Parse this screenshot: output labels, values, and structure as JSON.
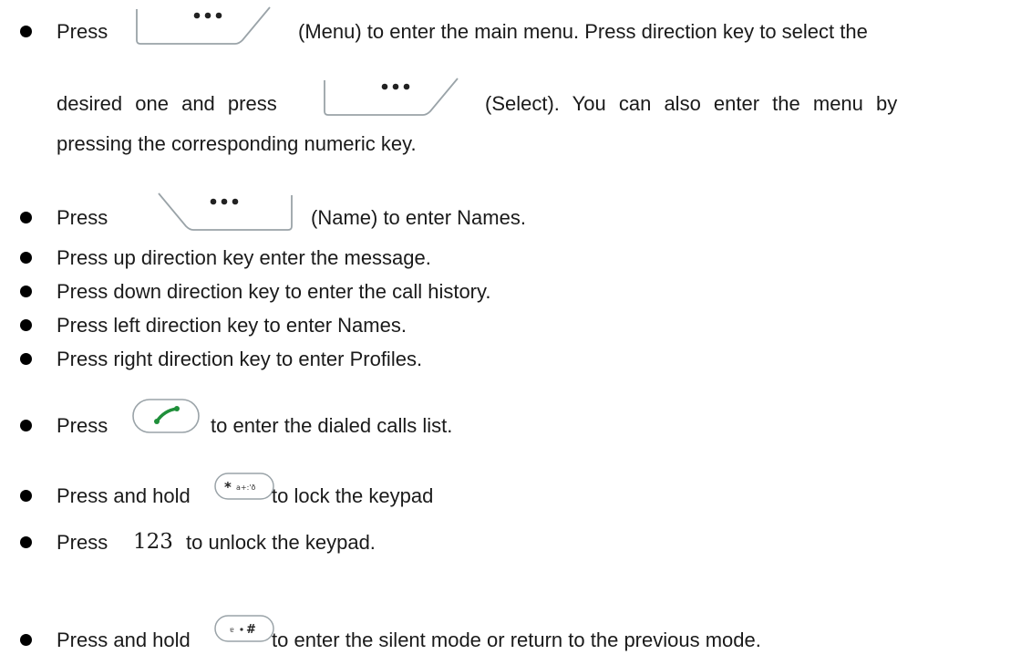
{
  "items": [
    {
      "lines": [
        {
          "before": "Press",
          "after": "(Menu) to enter the main menu. Press direction key to select the"
        },
        {
          "before": "desired one and press",
          "after": "(Select). You can also enter the menu by"
        },
        {
          "text": "pressing the corresponding numeric key."
        }
      ]
    },
    {
      "before": "Press",
      "after": "(Name) to enter Names."
    },
    {
      "text": "Press up direction key enter the message."
    },
    {
      "text": "Press down direction key to enter the call history."
    },
    {
      "text": "Press left direction key to enter Names."
    },
    {
      "text": "Press right direction key to enter Profiles."
    },
    {
      "before": "Press",
      "after": "to enter the dialed calls list."
    },
    {
      "before": "Press and hold",
      "after": "to lock the keypad"
    },
    {
      "before": "Press",
      "number": "123",
      "after": "to unlock the keypad."
    },
    {
      "before": "Press and hold",
      "after": "to enter the silent mode or return to the previous mode."
    }
  ],
  "icons": {
    "left_softkey": "left-softkey-icon",
    "right_softkey": "right-softkey-icon",
    "call_key": "call-key-icon",
    "star_key": "star-key-icon",
    "hash_key": "hash-key-icon"
  },
  "colors": {
    "call_green": "#1f8f3a",
    "key_outline": "#9aa3a8"
  }
}
